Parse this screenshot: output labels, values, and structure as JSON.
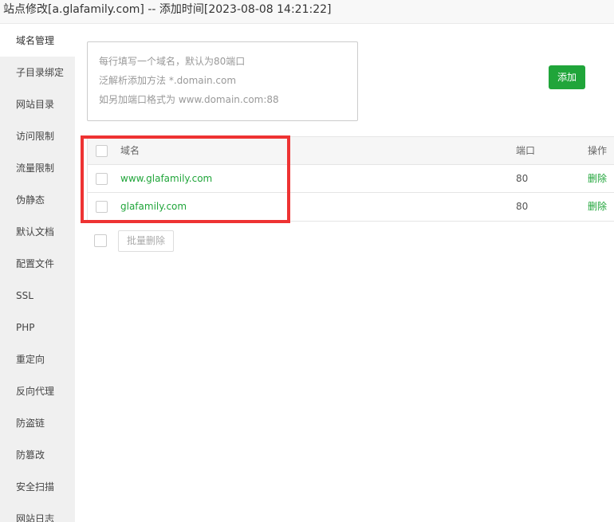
{
  "window": {
    "title": "站点修改[a.glafamily.com] -- 添加时间[2023-08-08 14:21:22]"
  },
  "sidebar": {
    "items": [
      {
        "label": "域名管理",
        "active": true
      },
      {
        "label": "子目录绑定"
      },
      {
        "label": "网站目录"
      },
      {
        "label": "访问限制"
      },
      {
        "label": "流量限制"
      },
      {
        "label": "伪静态"
      },
      {
        "label": "默认文档"
      },
      {
        "label": "配置文件"
      },
      {
        "label": "SSL"
      },
      {
        "label": "PHP"
      },
      {
        "label": "重定向"
      },
      {
        "label": "反向代理"
      },
      {
        "label": "防盗链"
      },
      {
        "label": "防篡改"
      },
      {
        "label": "安全扫描"
      },
      {
        "label": "网站日志"
      }
    ]
  },
  "domain_input": {
    "placeholder_lines": [
      "每行填写一个域名，默认为80端口",
      "泛解析添加方法 *.domain.com",
      "如另加端口格式为 www.domain.com:88"
    ]
  },
  "add_button": {
    "label": "添加"
  },
  "table": {
    "headers": {
      "name": "域名",
      "port": "端口",
      "action": "操作"
    },
    "rows": [
      {
        "domain": "www.glafamily.com",
        "port": "80",
        "action": "删除"
      },
      {
        "domain": "glafamily.com",
        "port": "80",
        "action": "删除"
      }
    ]
  },
  "batch_delete_button": {
    "label": "批量删除"
  },
  "colors": {
    "accent": "#20a53a",
    "highlight": "#ee3333",
    "sidebar_bg": "#f0f0f0"
  }
}
